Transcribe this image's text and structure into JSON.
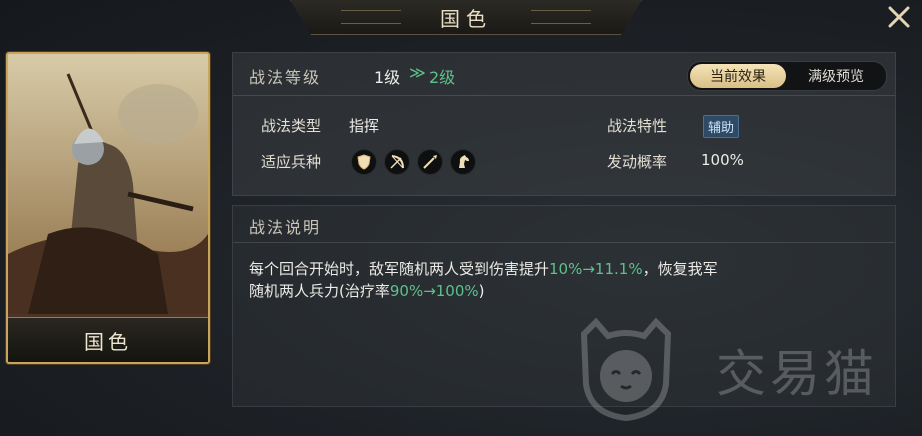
{
  "header": {
    "title": "国色"
  },
  "card": {
    "name": "国色"
  },
  "level": {
    "label": "战法等级",
    "current": "1级",
    "arrow": "≫",
    "next": "2级"
  },
  "toggle": {
    "active_label": "当前效果",
    "inactive_label": "满级预览"
  },
  "attributes": {
    "type_label": "战法类型",
    "type_value": "指挥",
    "trait_label": "战法特性",
    "trait_value": "辅助",
    "units_label": "适应兵种",
    "units": [
      "shield-icon",
      "bow-icon",
      "spear-icon",
      "horse-icon"
    ],
    "rate_label": "发动概率",
    "rate_value": "100%"
  },
  "description": {
    "title": "战法说明",
    "part1": "每个回合开始时，敌军随机两人受到伤害提升",
    "part2": "10%→11.1%",
    "part3": "，恢复我军随机两人兵力(治疗率",
    "part4": "90%→100%",
    "part5": ")"
  },
  "watermark": {
    "text": "交易猫"
  },
  "colors": {
    "accent_green": "#5ec08a",
    "gold": "#c9a45a"
  }
}
